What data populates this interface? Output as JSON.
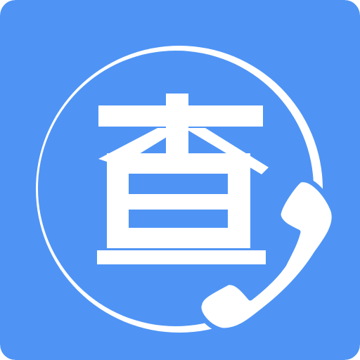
{
  "app_icon": {
    "glyph": "查",
    "icon_name": "phone-handset-icon",
    "colors": {
      "background": "#4f94f5",
      "foreground": "#ffffff"
    }
  }
}
